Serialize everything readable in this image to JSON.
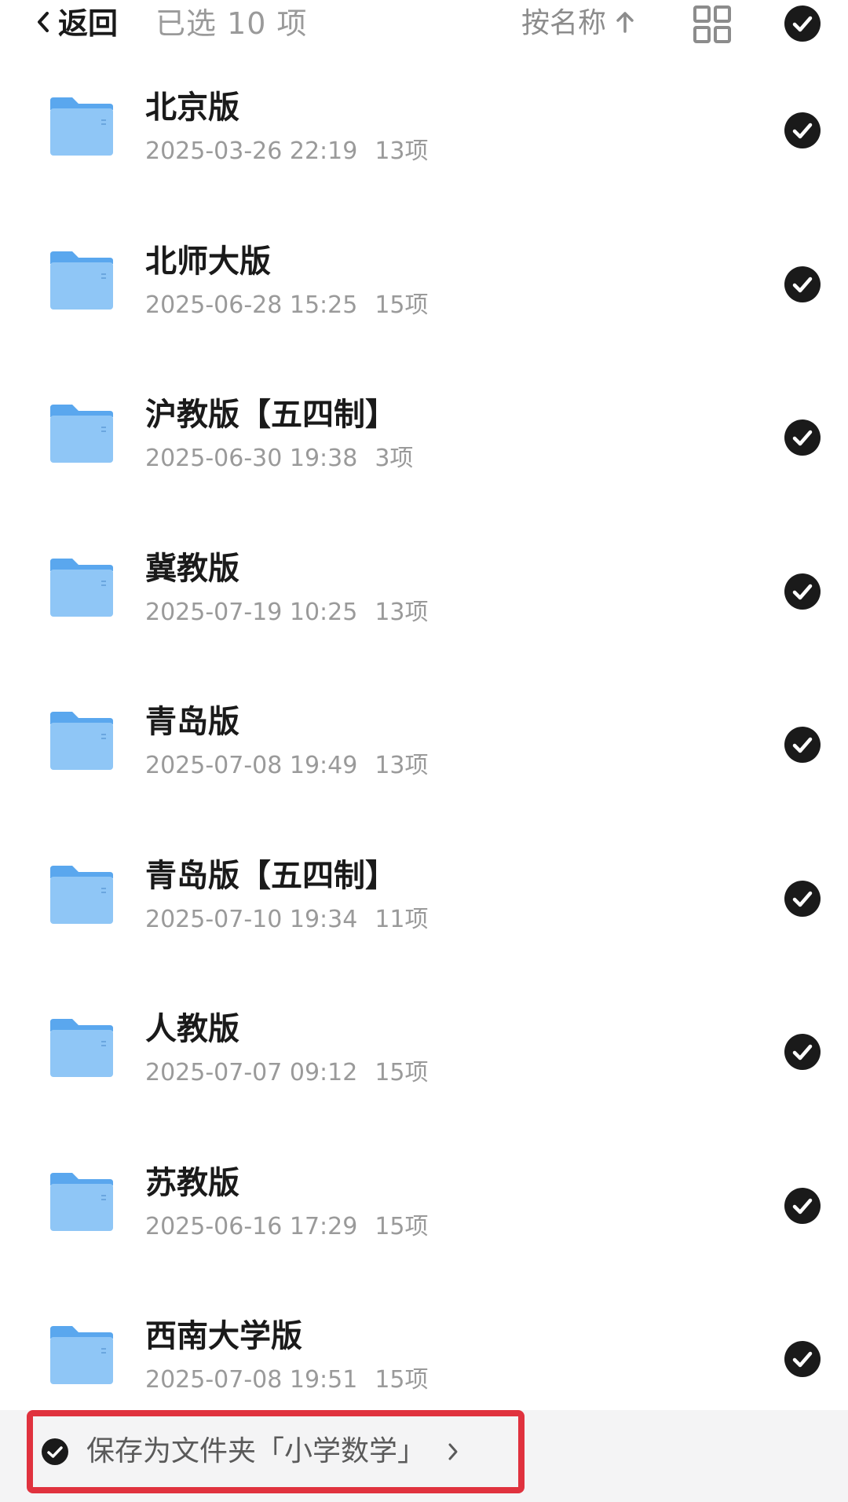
{
  "header": {
    "back_label": "返回",
    "selected_count": "已选 10 项",
    "sort_label": "按名称"
  },
  "folders": [
    {
      "name": "北京版",
      "date": "2025-03-26 22:19",
      "count": "13项"
    },
    {
      "name": "北师大版",
      "date": "2025-06-28 15:25",
      "count": "15项"
    },
    {
      "name": "沪教版【五四制】",
      "date": "2025-06-30 19:38",
      "count": "3项"
    },
    {
      "name": "冀教版",
      "date": "2025-07-19 10:25",
      "count": "13项"
    },
    {
      "name": "青岛版",
      "date": "2025-07-08 19:49",
      "count": "13项"
    },
    {
      "name": "青岛版【五四制】",
      "date": "2025-07-10 19:34",
      "count": "11项"
    },
    {
      "name": "人教版",
      "date": "2025-07-07 09:12",
      "count": "15项"
    },
    {
      "name": "苏教版",
      "date": "2025-06-16 17:29",
      "count": "15项"
    },
    {
      "name": "西南大学版",
      "date": "2025-07-08 19:51",
      "count": "15项"
    }
  ],
  "bottom_bar": {
    "save_label": "保存为文件夹「小学数学」"
  },
  "icons": {
    "back": "chevron-left-icon",
    "sort": "arrow-up-icon",
    "grid": "grid-view-icon",
    "check": "check-circle-icon",
    "folder": "folder-icon",
    "chevron": "chevron-right-icon"
  },
  "colors": {
    "folder_blue": "#6db3f2",
    "check_fill": "#1a1a1a",
    "highlight_border": "#e0323e",
    "meta_gray": "#9a9a9a"
  }
}
